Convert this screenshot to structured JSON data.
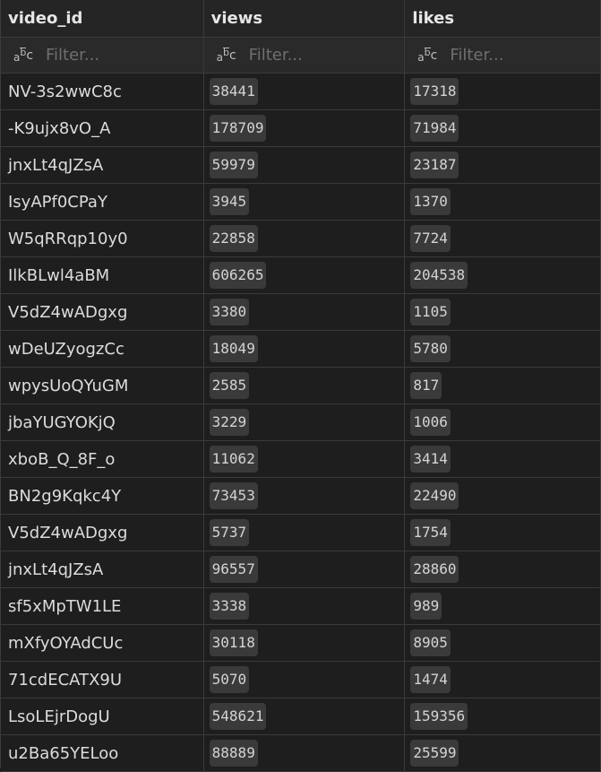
{
  "columns": [
    {
      "label": "video_id",
      "filter_placeholder": "Filter..."
    },
    {
      "label": "views",
      "filter_placeholder": "Filter..."
    },
    {
      "label": "likes",
      "filter_placeholder": "Filter..."
    }
  ],
  "rows": [
    {
      "video_id": "NV-3s2wwC8c",
      "views": "38441",
      "likes": "17318"
    },
    {
      "video_id": "-K9ujx8vO_A",
      "views": "178709",
      "likes": "71984"
    },
    {
      "video_id": "jnxLt4qJZsA",
      "views": "59979",
      "likes": "23187"
    },
    {
      "video_id": "IsyAPf0CPaY",
      "views": "3945",
      "likes": "1370"
    },
    {
      "video_id": "W5qRRqp10y0",
      "views": "22858",
      "likes": "7724"
    },
    {
      "video_id": "IlkBLwl4aBM",
      "views": "606265",
      "likes": "204538"
    },
    {
      "video_id": "V5dZ4wADgxg",
      "views": "3380",
      "likes": "1105"
    },
    {
      "video_id": "wDeUZyogzCc",
      "views": "18049",
      "likes": "5780"
    },
    {
      "video_id": "wpysUoQYuGM",
      "views": "2585",
      "likes": "817"
    },
    {
      "video_id": "jbaYUGYOKjQ",
      "views": "3229",
      "likes": "1006"
    },
    {
      "video_id": "xboB_Q_8F_o",
      "views": "11062",
      "likes": "3414"
    },
    {
      "video_id": "BN2g9Kqkc4Y",
      "views": "73453",
      "likes": "22490"
    },
    {
      "video_id": "V5dZ4wADgxg",
      "views": "5737",
      "likes": "1754"
    },
    {
      "video_id": "jnxLt4qJZsA",
      "views": "96557",
      "likes": "28860"
    },
    {
      "video_id": "sf5xMpTW1LE",
      "views": "3338",
      "likes": "989"
    },
    {
      "video_id": "mXfyOYAdCUc",
      "views": "30118",
      "likes": "8905"
    },
    {
      "video_id": "71cdECATX9U",
      "views": "5070",
      "likes": "1474"
    },
    {
      "video_id": "LsoLEjrDogU",
      "views": "548621",
      "likes": "159356"
    },
    {
      "video_id": "u2Ba65YELoo",
      "views": "88889",
      "likes": "25599"
    }
  ],
  "icons": {
    "filter_type": "abc-type-icon"
  },
  "colors": {
    "background": "#1e1e1e",
    "pill": "#3a3a3a",
    "text": "#dcdcdc"
  }
}
